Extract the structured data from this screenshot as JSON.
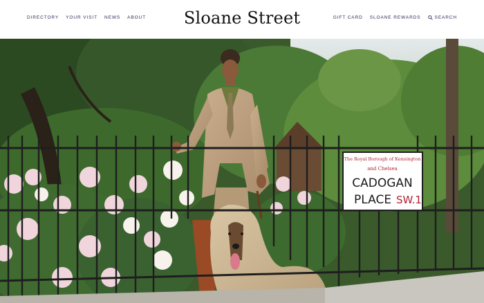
{
  "header": {
    "logo_text": "Sloane Street",
    "left_nav": [
      "DIRECTORY",
      "YOUR VISIT",
      "NEWS",
      "ABOUT"
    ],
    "right_nav": [
      "GIFT CARD",
      "SLOANE REWARDS"
    ],
    "search_label": "SEARCH",
    "search_icon": "search-icon"
  },
  "hero": {
    "sign": {
      "line1": "The Royal Borough of Kensington",
      "line2": "and Chelsea",
      "line3": "CADOGAN",
      "line4_main": "PLACE",
      "line4_code": "SW.1"
    }
  }
}
